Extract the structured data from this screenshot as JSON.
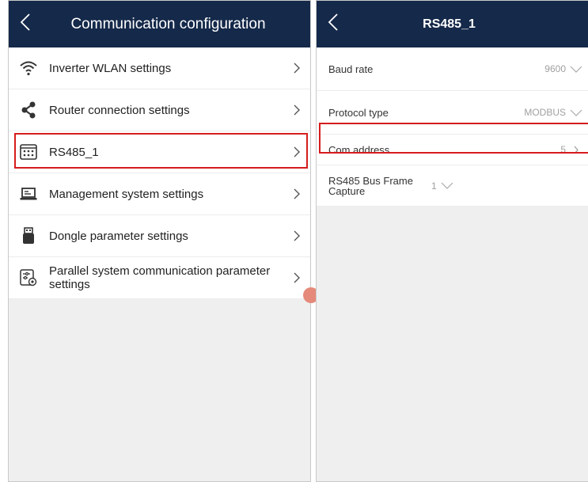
{
  "left": {
    "title": "Communication configuration",
    "items": [
      {
        "label": "Inverter WLAN settings",
        "icon": "wifi-icon"
      },
      {
        "label": "Router connection settings",
        "icon": "share-icon"
      },
      {
        "label": "RS485_1",
        "icon": "rs485-port-icon"
      },
      {
        "label": "Management system settings",
        "icon": "laptop-icon"
      },
      {
        "label": "Dongle parameter settings",
        "icon": "usb-dongle-icon"
      },
      {
        "label": "Parallel system communication parameter settings",
        "icon": "settings-sliders-icon"
      }
    ]
  },
  "right": {
    "title": "RS485_1",
    "items": [
      {
        "label": "Baud rate",
        "value": "9600"
      },
      {
        "label": "Protocol type",
        "value": "MODBUS"
      },
      {
        "label": "Com address",
        "value": "5"
      },
      {
        "label": "RS485 Bus Frame Capture",
        "value": "1"
      }
    ]
  },
  "colors": {
    "header": "#15294a",
    "highlight": "#d61c1c",
    "background": "#efefef"
  }
}
